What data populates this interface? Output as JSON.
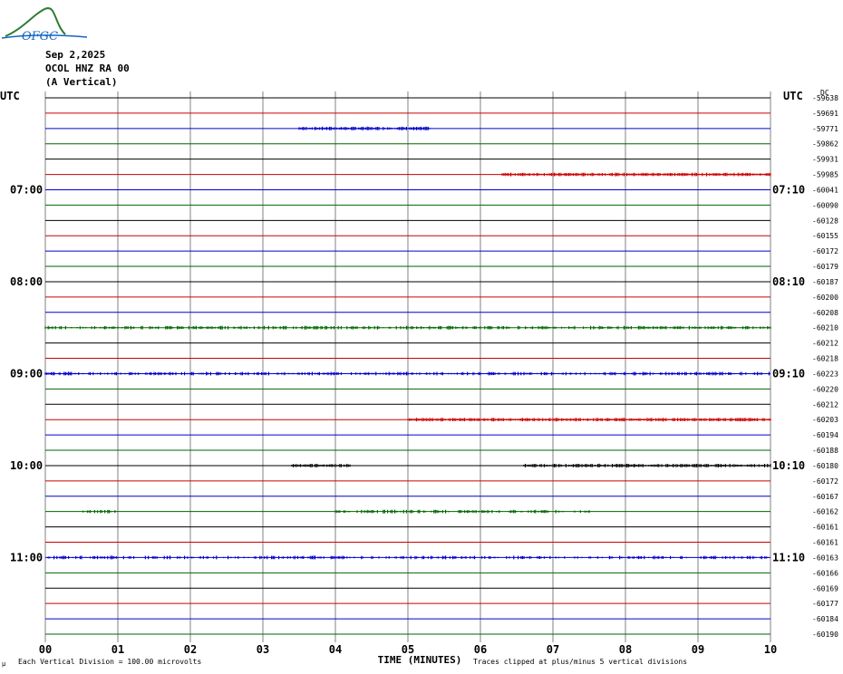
{
  "header": {
    "date": "Sep 2,2025",
    "station": "OCOL HNZ RA 00",
    "component": "(A Vertical)",
    "logo_text": "OFGC"
  },
  "footer": {
    "scale_note": "Each Vertical Division =  100.00 microvolts",
    "clip_note": "Traces clipped at plus/minus 5 vertical divisions",
    "corner_mark": "μ"
  },
  "colors": {
    "black": "#000000",
    "red": "#cc0000",
    "blue": "#0000cc",
    "green": "#006600",
    "grid": "#808080"
  },
  "chart_data": {
    "type": "line",
    "title": "",
    "xlabel": "TIME (MINUTES)",
    "ylabel": "",
    "left_axis_label": "UTC",
    "right_axis_label": "UTC",
    "xlim": [
      0,
      10
    ],
    "x_ticks": [
      "00",
      "01",
      "02",
      "03",
      "04",
      "05",
      "06",
      "07",
      "08",
      "09",
      "10"
    ],
    "trace_count": 36,
    "color_cycle": [
      "black",
      "red",
      "blue",
      "green"
    ],
    "left_hour_labels": [
      {
        "trace": 6,
        "label": "07:00"
      },
      {
        "trace": 12,
        "label": "08:00"
      },
      {
        "trace": 18,
        "label": "09:00"
      },
      {
        "trace": 24,
        "label": "10:00"
      },
      {
        "trace": 30,
        "label": "11:00"
      }
    ],
    "right_hour_labels": [
      {
        "trace": 6,
        "label": "07:10"
      },
      {
        "trace": 12,
        "label": "08:10"
      },
      {
        "trace": 18,
        "label": "09:10"
      },
      {
        "trace": 24,
        "label": "10:10"
      },
      {
        "trace": 30,
        "label": "11:10"
      }
    ],
    "right_values": [
      "-59638",
      "-59691",
      "-59771",
      "-59862",
      "-59931",
      "-59985",
      "-60041",
      "-60090",
      "-60128",
      "-60155",
      "-60172",
      "-60179",
      "-60187",
      "-60200",
      "-60208",
      "-60210",
      "-60212",
      "-60218",
      "-60223",
      "-60220",
      "-60212",
      "-60203",
      "-60194",
      "-60188",
      "-60180",
      "-60172",
      "-60167",
      "-60162",
      "-60161",
      "-60161",
      "-60163",
      "-60166",
      "-60169",
      "-60177",
      "-60184",
      "-60190"
    ],
    "right_top_mark": "DC",
    "activity": [
      {
        "trace": 2,
        "ranges": [
          [
            3.5,
            5.3
          ]
        ],
        "level": 1.0
      },
      {
        "trace": 5,
        "ranges": [
          [
            6.3,
            10.0
          ]
        ],
        "level": 1.0
      },
      {
        "trace": 15,
        "ranges": [
          [
            0.0,
            10.0
          ]
        ],
        "level": 0.6
      },
      {
        "trace": 18,
        "ranges": [
          [
            0.0,
            10.0
          ]
        ],
        "level": 0.6
      },
      {
        "trace": 21,
        "ranges": [
          [
            5.0,
            10.0
          ]
        ],
        "level": 1.0
      },
      {
        "trace": 24,
        "ranges": [
          [
            3.4,
            4.2
          ],
          [
            6.6,
            10.0
          ]
        ],
        "level": 1.0
      },
      {
        "trace": 27,
        "ranges": [
          [
            0.5,
            1.0
          ],
          [
            4.0,
            7.5
          ]
        ],
        "level": 0.6
      },
      {
        "trace": 30,
        "ranges": [
          [
            0.0,
            10.0
          ]
        ],
        "level": 0.5
      }
    ]
  }
}
